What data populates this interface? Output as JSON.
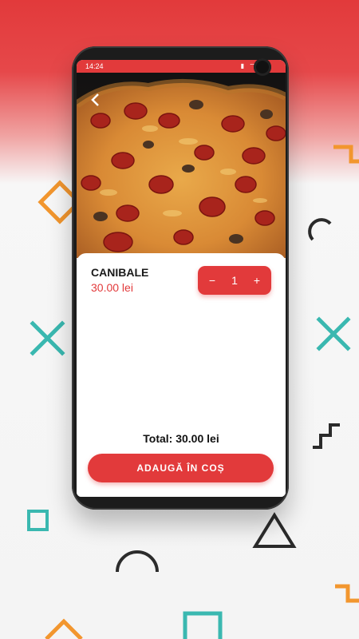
{
  "status_bar": {
    "time": "14:24",
    "icons": "▮ ⌔ ▾"
  },
  "product": {
    "name": "CANIBALE",
    "price": "30.00 lei",
    "quantity": "1",
    "minus_label": "−",
    "plus_label": "+"
  },
  "footer": {
    "total_text": "Total: 30.00 lei",
    "add_button_label": "ADAUGĂ ÎN COȘ"
  },
  "colors": {
    "accent": "#e23a3b",
    "orange": "#f2962e",
    "teal": "#3ab8b0",
    "dark": "#2b2b2b"
  },
  "icons": [
    "back-arrow-icon",
    "battery-icon",
    "wifi-icon",
    "signal-icon",
    "camera-icon"
  ]
}
